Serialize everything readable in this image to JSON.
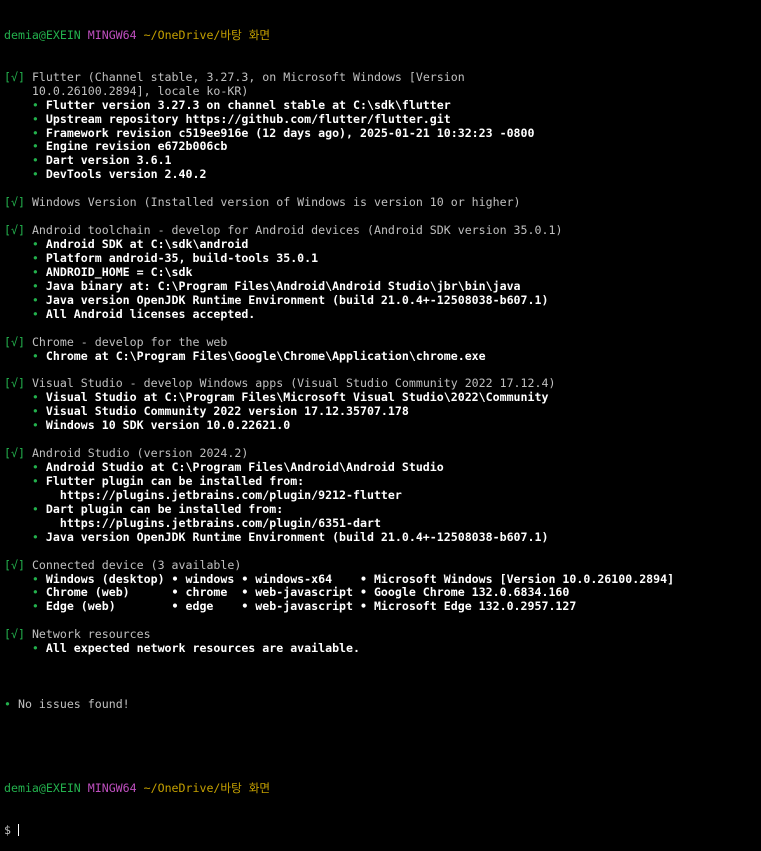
{
  "prompt": {
    "user_host": "demia@EXEIN",
    "shell": "MINGW64",
    "path": "~/OneDrive/바탕 화면",
    "dollar": "$"
  },
  "colors": {
    "background": "#000000",
    "check": "#23b14d",
    "bullet": "#23b14d",
    "text": "#c0c0c0",
    "bold": "#ffffff",
    "shell": "#bf4fbf",
    "path": "#c4a000"
  },
  "sections": [
    {
      "check": "[√]",
      "header_lines": [
        "Flutter (Channel stable, 3.27.3, on Microsoft Windows [Version",
        "10.0.26100.2894], locale ko-KR)"
      ],
      "items": [
        "Flutter version 3.27.3 on channel stable at C:\\sdk\\flutter",
        "Upstream repository https://github.com/flutter/flutter.git",
        "Framework revision c519ee916e (12 days ago), 2025-01-21 10:32:23 -0800",
        "Engine revision e672b006cb",
        "Dart version 3.6.1",
        "DevTools version 2.40.2"
      ]
    },
    {
      "check": "[√]",
      "header_lines": [
        "Windows Version (Installed version of Windows is version 10 or higher)"
      ],
      "items": []
    },
    {
      "check": "[√]",
      "header_lines": [
        "Android toolchain - develop for Android devices (Android SDK version 35.0.1)"
      ],
      "items": [
        "Android SDK at C:\\sdk\\android",
        "Platform android-35, build-tools 35.0.1",
        "ANDROID_HOME = C:\\sdk",
        "Java binary at: C:\\Program Files\\Android\\Android Studio\\jbr\\bin\\java",
        "Java version OpenJDK Runtime Environment (build 21.0.4+-12508038-b607.1)",
        "All Android licenses accepted."
      ]
    },
    {
      "check": "[√]",
      "header_lines": [
        "Chrome - develop for the web"
      ],
      "items": [
        "Chrome at C:\\Program Files\\Google\\Chrome\\Application\\chrome.exe"
      ]
    },
    {
      "check": "[√]",
      "header_lines": [
        "Visual Studio - develop Windows apps (Visual Studio Community 2022 17.12.4)"
      ],
      "items": [
        "Visual Studio at C:\\Program Files\\Microsoft Visual Studio\\2022\\Community",
        "Visual Studio Community 2022 version 17.12.35707.178",
        "Windows 10 SDK version 10.0.22621.0"
      ]
    },
    {
      "check": "[√]",
      "header_lines": [
        "Android Studio (version 2024.2)"
      ],
      "items": [
        "Android Studio at C:\\Program Files\\Android\\Android Studio",
        "Flutter plugin can be installed from:\n  https://plugins.jetbrains.com/plugin/9212-flutter",
        "Dart plugin can be installed from:\n  https://plugins.jetbrains.com/plugin/6351-dart",
        "Java version OpenJDK Runtime Environment (build 21.0.4+-12508038-b607.1)"
      ]
    },
    {
      "check": "[√]",
      "header_lines": [
        "Connected device (3 available)"
      ],
      "items": [
        "Windows (desktop) • windows • windows-x64    • Microsoft Windows [Version 10.0.26100.2894]",
        "Chrome (web)      • chrome  • web-javascript • Google Chrome 132.0.6834.160",
        "Edge (web)        • edge    • web-javascript • Microsoft Edge 132.0.2957.127"
      ]
    },
    {
      "check": "[√]",
      "header_lines": [
        "Network resources"
      ],
      "items": [
        "All expected network resources are available."
      ]
    }
  ],
  "summary": {
    "bullet": "•",
    "text": "No issues found!"
  }
}
